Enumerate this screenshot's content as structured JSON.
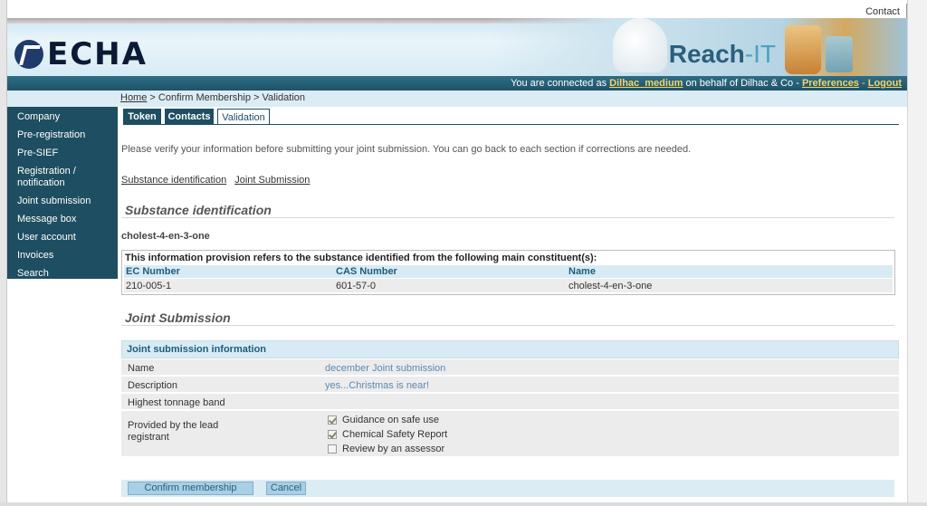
{
  "header": {
    "contact_label": "Contact",
    "logo_text": "ECHA",
    "app_name_main": "Reach",
    "app_name_suffix": "-IT"
  },
  "userbar": {
    "prefix": "You are connected as",
    "username": "Dilhac_medium",
    "middle": "on behalf of Dilhac & Co -",
    "preferences": "Preferences",
    "separator": "-",
    "logout": "Logout"
  },
  "breadcrumb": {
    "home": "Home",
    "rest": "> Confirm Membership > Validation"
  },
  "sidebar": {
    "items": [
      {
        "label": "Company"
      },
      {
        "label": "Pre-registration"
      },
      {
        "label": "Pre-SIEF"
      },
      {
        "label": "Registration / notification"
      },
      {
        "label": "Joint submission"
      },
      {
        "label": "Message box"
      },
      {
        "label": "User account"
      },
      {
        "label": "Invoices"
      },
      {
        "label": "Search"
      }
    ]
  },
  "tabs": [
    {
      "label": "Token"
    },
    {
      "label": "Contacts"
    },
    {
      "label": "Validation"
    }
  ],
  "active_tab": "Validation",
  "intro_text": "Please verify your information before submitting your joint submission. You can go back to each section if corrections are needed.",
  "sublinks": [
    {
      "label": "Substance identification"
    },
    {
      "label": "Joint Submission"
    }
  ],
  "substance": {
    "section_title": "Substance identification",
    "name": "cholest-4-en-3-one",
    "caption": "This information provision refers to the substance identified from the following main constituent(s):",
    "columns": [
      "EC Number",
      "CAS Number",
      "Name"
    ],
    "rows": [
      [
        "210-005-1",
        "601-57-0",
        "cholest-4-en-3-one"
      ]
    ]
  },
  "joint": {
    "section_title": "Joint Submission",
    "box_title": "Joint submission information",
    "name_label": "Name",
    "name_value": "december Joint submission",
    "description_label": "Description",
    "description_value": "yes...Christmas is near!",
    "tonnage_label": "Highest tonnage band",
    "tonnage_value": "",
    "provided_label": "Provided by the lead registrant",
    "checkboxes": [
      {
        "label": "Guidance on safe use",
        "checked": true
      },
      {
        "label": "Chemical Safety Report",
        "checked": true
      },
      {
        "label": "Review by an assessor",
        "checked": false
      }
    ]
  },
  "buttons": {
    "confirm": "Confirm membership",
    "cancel": "Cancel"
  },
  "colors": {
    "nav_bg": "#1e4e61",
    "accent_blue": "#1e5c7d",
    "link_yellow": "#f5d36a",
    "button_bg": "#a8cfe3"
  }
}
